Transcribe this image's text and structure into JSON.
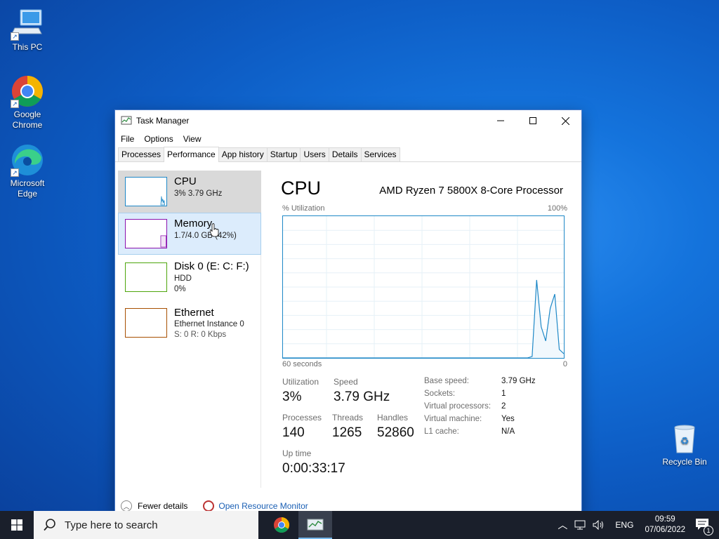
{
  "desktop": {
    "icons": [
      {
        "label_line1": "This PC",
        "label_line2": ""
      },
      {
        "label_line1": "Google",
        "label_line2": "Chrome"
      },
      {
        "label_line1": "Microsoft",
        "label_line2": "Edge"
      },
      {
        "label_line1": "Recycle Bin",
        "label_line2": ""
      }
    ]
  },
  "window": {
    "title": "Task Manager",
    "menu": [
      "File",
      "Options",
      "View"
    ],
    "tabs": [
      "Processes",
      "Performance",
      "App history",
      "Startup",
      "Users",
      "Details",
      "Services"
    ],
    "active_tab": "Performance"
  },
  "sidebar": {
    "items": [
      {
        "name": "CPU",
        "sub1": "3% 3.79 GHz",
        "sub2": "",
        "color": "#1e88c7"
      },
      {
        "name": "Memory",
        "sub1": "1.7/4.0 GB (42%)",
        "sub2": "",
        "color": "#8b12ae"
      },
      {
        "name": "Disk 0 (E: C: F:)",
        "sub1": "HDD",
        "sub2": "0%",
        "color": "#4da60c"
      },
      {
        "name": "Ethernet",
        "sub1": "Ethernet Instance 0",
        "sub2": "S: 0 R: 0 Kbps",
        "color": "#a74f01"
      }
    ]
  },
  "cpu": {
    "title": "CPU",
    "processor": "AMD Ryzen 7 5800X 8-Core Processor",
    "graph_label": "% Utilization",
    "graph_max": "100%",
    "time_label": "60 seconds",
    "time_min": "0",
    "utilization_label": "Utilization",
    "utilization": "3%",
    "speed_label": "Speed",
    "speed": "3.79 GHz",
    "processes_label": "Processes",
    "processes": "140",
    "threads_label": "Threads",
    "threads": "1265",
    "handles_label": "Handles",
    "handles": "52860",
    "uptime_label": "Up time",
    "uptime": "0:00:33:17",
    "specs": [
      {
        "key": "Base speed:",
        "value": "3.79 GHz"
      },
      {
        "key": "Sockets:",
        "value": "1"
      },
      {
        "key": "Virtual processors:",
        "value": "2"
      },
      {
        "key": "Virtual machine:",
        "value": "Yes"
      },
      {
        "key": "L1 cache:",
        "value": "N/A"
      }
    ],
    "usage_history_percent": [
      0,
      0,
      0,
      0,
      0,
      0,
      0,
      0,
      0,
      0,
      0,
      0,
      0,
      0,
      0,
      0,
      0,
      0,
      0,
      0,
      0,
      0,
      0,
      0,
      0,
      0,
      0,
      0,
      0,
      0,
      0,
      0,
      0,
      0,
      0,
      0,
      0,
      0,
      0,
      0,
      0,
      0,
      0,
      0,
      0,
      0,
      0,
      0,
      0,
      0,
      0,
      0,
      0,
      0,
      0,
      1,
      55,
      22,
      12,
      35,
      45,
      6,
      3
    ]
  },
  "footer": {
    "fewer_details": "Fewer details",
    "resource_monitor": "Open Resource Monitor"
  },
  "taskbar": {
    "search_placeholder": "Type here to search",
    "language": "ENG",
    "time": "09:59",
    "date": "07/06/2022",
    "notification_count": "1"
  }
}
